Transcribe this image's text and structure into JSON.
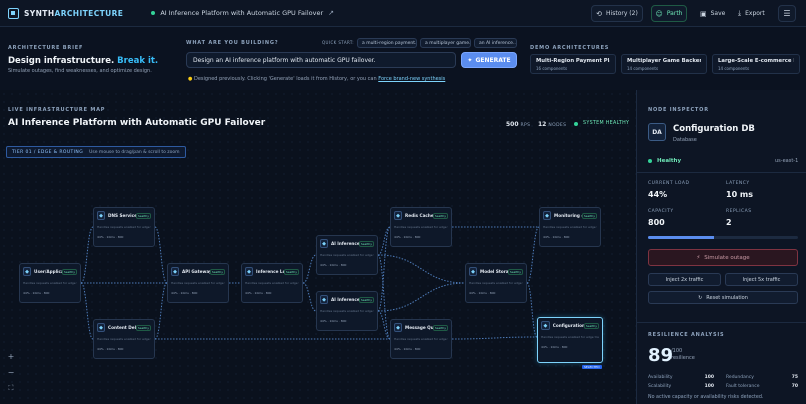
{
  "app": {
    "brand_a": "SYNTH",
    "brand_b": "ARCHITECTURE",
    "project": "AI Inference Platform with Automatic GPU Failover"
  },
  "toolbar": {
    "history": "History (2)",
    "user": "Parth",
    "save": "Save",
    "export": "Export"
  },
  "brief": {
    "label": "ARCHITECTURE BRIEF",
    "title_a": "Design infrastructure.",
    "title_b": "Break it.",
    "subtitle": "Simulate outages, find weaknesses, and optimize design."
  },
  "builder": {
    "label": "WHAT ARE YOU BUILDING?",
    "quick_label": "QUICK START:",
    "chips": [
      "a multi-region payment...",
      "a multiplayer game...",
      "an AI inference..."
    ],
    "input_value": "Design an AI inference platform with automatic GPU failover.",
    "generate": "GENERATE",
    "hint": "Designed previously. Clicking 'Generate' loads it from History, or you can",
    "hint_link": "Force brand-new synthesis"
  },
  "demos": {
    "label": "DEMO ARCHITECTURES",
    "items": [
      {
        "title": "Multi-Region Payment Platform",
        "sub": "16 components"
      },
      {
        "title": "Multiplayer Game Backend",
        "sub": "14 components"
      },
      {
        "title": "Large-Scale E-commerce Platform",
        "sub": "14 components"
      }
    ]
  },
  "map": {
    "label": "LIVE INFRASTRUCTURE MAP",
    "title": "AI Inference Platform with Automatic GPU Failover",
    "rps": "500",
    "rps_unit": "RPS",
    "nodes": "12",
    "nodes_unit": "NODES",
    "health": "SYSTEM HEALTHY",
    "tier": "TIER 01 / EDGE & ROUTING",
    "tier_hint": "Use mouse to drag/pan & scroll to zoom",
    "zoom_in": "+",
    "zoom_out": "−",
    "fit": "⛶"
  },
  "nodes": [
    {
      "name": "User/Application...",
      "desc": "Handles requests enabled for edge traffic",
      "badge": "healthy"
    },
    {
      "name": "DNS Service",
      "desc": "Handles requests enabled for edge traffic",
      "badge": "healthy"
    },
    {
      "name": "Content Delivery...",
      "desc": "Handles requests enabled for edge traffic",
      "badge": "healthy"
    },
    {
      "name": "API Gateway",
      "desc": "Handles requests enabled for edge traffic",
      "badge": "healthy"
    },
    {
      "name": "Inference Load B...",
      "desc": "Handles requests enabled for edge traffic",
      "badge": "healthy"
    },
    {
      "name": "AI Inference Ser...",
      "desc": "Handles requests enabled for edge traffic",
      "badge": "healthy"
    },
    {
      "name": "AI Inference Ser...",
      "desc": "Handles requests enabled for edge traffic",
      "badge": "healthy"
    },
    {
      "name": "Redis Cache",
      "desc": "Handles requests enabled for edge traffic",
      "badge": "healthy"
    },
    {
      "name": "Message Queue ...",
      "desc": "Handles requests enabled for edge traffic",
      "badge": "healthy"
    },
    {
      "name": "Model Storage ...",
      "desc": "Handles requests enabled for edge traffic",
      "badge": "healthy"
    },
    {
      "name": "Monitoring & Al...",
      "desc": "Handles requests enabled for edge traffic",
      "badge": "healthy"
    },
    {
      "name": "Configuration DB",
      "desc": "Handles requests enabled for edge traffic",
      "badge": "healthy"
    }
  ],
  "node_metrics": {
    "load": "44%",
    "lat": "10ms",
    "cap": "800",
    "selected_tag": "SELECTED"
  },
  "inspector": {
    "label": "NODE INSPECTOR",
    "avatar": "DA",
    "title": "Configuration DB",
    "type": "Database",
    "status": "Healthy",
    "region": "us-east-1",
    "load_label": "CURRENT LOAD",
    "load": "44%",
    "latency_label": "LATENCY",
    "latency": "10 ms",
    "capacity_label": "CAPACITY",
    "capacity": "800",
    "replicas_label": "REPLICAS",
    "replicas": "2",
    "capacity_fill": 0.44,
    "simulate": "Simulate outage",
    "inject2": "Inject 2x traffic",
    "inject5": "Inject 5x traffic",
    "reset": "Reset simulation"
  },
  "resilience": {
    "label": "RESILIENCE ANALYSIS",
    "score": "89",
    "score_max": "/100",
    "score_word": "resilience",
    "rows": [
      {
        "k": "Availability",
        "v": "100"
      },
      {
        "k": "Redundancy",
        "v": "75"
      },
      {
        "k": "Scalability",
        "v": "100"
      },
      {
        "k": "Fault tolerance",
        "v": "70"
      }
    ],
    "note": "No active capacity or availability risks detected."
  },
  "colors": {
    "accent": "#38bdf8",
    "healthy": "#34d399",
    "edge": "#5b8fd6",
    "danger": "#7f3341"
  }
}
